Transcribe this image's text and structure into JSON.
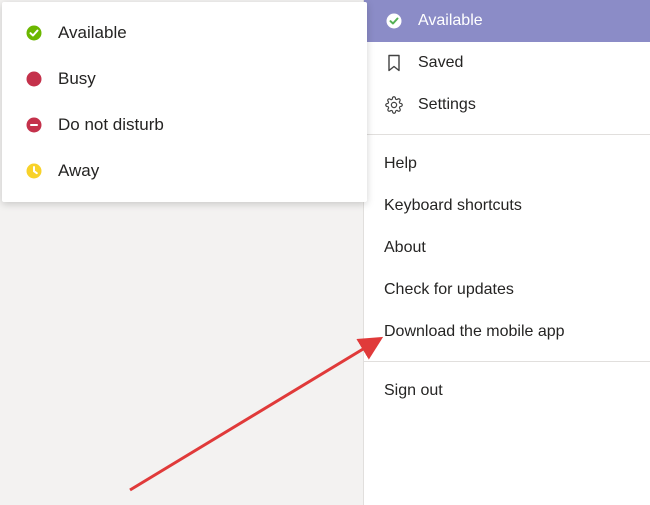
{
  "status_popup": {
    "items": [
      {
        "label": "Available",
        "icon": "available"
      },
      {
        "label": "Busy",
        "icon": "busy"
      },
      {
        "label": "Do not disturb",
        "icon": "dnd"
      },
      {
        "label": "Away",
        "icon": "away"
      }
    ]
  },
  "profile_menu": {
    "status": {
      "label": "Available",
      "icon": "available"
    },
    "saved": {
      "label": "Saved"
    },
    "settings": {
      "label": "Settings"
    },
    "help": {
      "label": "Help"
    },
    "keyboard_shortcuts": {
      "label": "Keyboard shortcuts"
    },
    "about": {
      "label": "About"
    },
    "check_updates": {
      "label": "Check for updates"
    },
    "download_app": {
      "label": "Download the mobile app"
    },
    "sign_out": {
      "label": "Sign out"
    }
  },
  "colors": {
    "selected_bg": "#8b8cc7",
    "available": "#6bb700",
    "busy": "#c4314b",
    "dnd": "#c4314b",
    "away": "#f8d22a"
  }
}
